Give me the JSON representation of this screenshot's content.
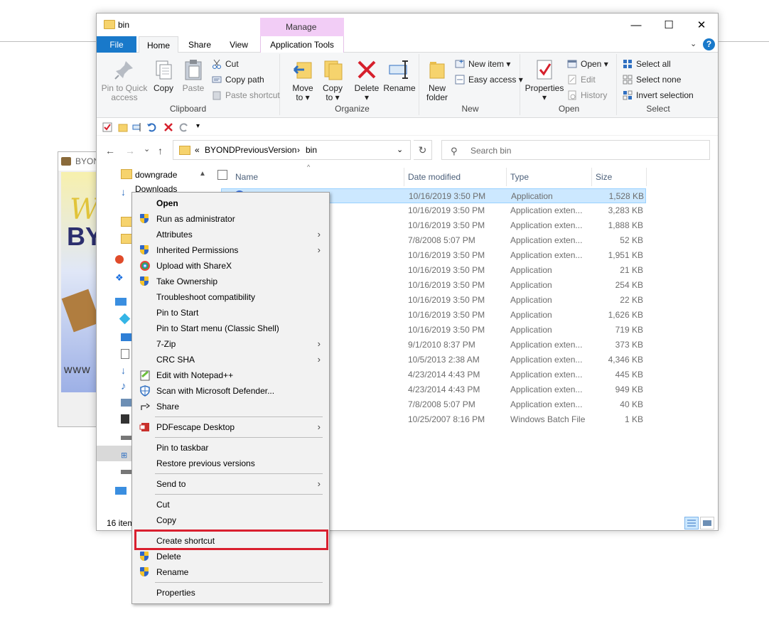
{
  "window": {
    "title": "bin",
    "manage_label": "Manage",
    "minimize": "—",
    "maximize": "☐",
    "close": "✕"
  },
  "tabs": {
    "file": "File",
    "home": "Home",
    "share": "Share",
    "view": "View",
    "app_tools": "Application Tools"
  },
  "ribbon": {
    "clipboard": {
      "label": "Clipboard",
      "pin_l1": "Pin to Quick",
      "pin_l2": "access",
      "copy": "Copy",
      "paste": "Paste",
      "cut": "Cut",
      "copy_path": "Copy path",
      "paste_shortcut": "Paste shortcut"
    },
    "organize": {
      "label": "Organize",
      "move_l1": "Move",
      "move_l2": "to ▾",
      "copy_l1": "Copy",
      "copy_l2": "to ▾",
      "delete_l1": "Delete",
      "delete_l2": "▾",
      "rename": "Rename"
    },
    "new": {
      "label": "New",
      "folder_l1": "New",
      "folder_l2": "folder",
      "new_item": "New item ▾",
      "easy_access": "Easy access ▾"
    },
    "open": {
      "label": "Open",
      "properties": "Properties",
      "properties_arrow": "▾",
      "open": "Open ▾",
      "edit": "Edit",
      "history": "History"
    },
    "select": {
      "label": "Select",
      "select_all": "Select all",
      "select_none": "Select none",
      "invert": "Invert selection"
    }
  },
  "address": {
    "back": "←",
    "forward": "→",
    "recent": "⌄",
    "up": "↑",
    "prefix": "«",
    "crumb1": "BYONDPreviousVersion",
    "sep": "›",
    "crumb2": "bin",
    "dropdown": "⌄",
    "refresh": "↻",
    "search_placeholder": "Search bin"
  },
  "nav": {
    "items": [
      "downgrade",
      "Downloads"
    ]
  },
  "columns": {
    "name": "Name",
    "date": "Date modified",
    "type": "Type",
    "size": "Size"
  },
  "files": [
    {
      "date": "10/16/2019 3:50 PM",
      "type": "Application",
      "size": "1,528 KB"
    },
    {
      "date": "10/16/2019 3:50 PM",
      "type": "Application exten...",
      "size": "3,283 KB"
    },
    {
      "date": "10/16/2019 3:50 PM",
      "type": "Application exten...",
      "size": "1,888 KB"
    },
    {
      "date": "7/8/2008 5:07 PM",
      "type": "Application exten...",
      "size": "52 KB"
    },
    {
      "date": "10/16/2019 3:50 PM",
      "type": "Application exten...",
      "size": "1,951 KB"
    },
    {
      "date": "10/16/2019 3:50 PM",
      "type": "Application",
      "size": "21 KB"
    },
    {
      "date": "10/16/2019 3:50 PM",
      "type": "Application",
      "size": "254 KB"
    },
    {
      "date": "10/16/2019 3:50 PM",
      "type": "Application",
      "size": "22 KB"
    },
    {
      "date": "10/16/2019 3:50 PM",
      "type": "Application",
      "size": "1,626 KB"
    },
    {
      "date": "10/16/2019 3:50 PM",
      "type": "Application",
      "size": "719 KB"
    },
    {
      "date": "9/1/2010 8:37 PM",
      "type": "Application exten...",
      "size": "373 KB"
    },
    {
      "date": "10/5/2013 2:38 AM",
      "type": "Application exten...",
      "size": "4,346 KB"
    },
    {
      "date": "4/23/2014 4:43 PM",
      "type": "Application exten...",
      "size": "445 KB"
    },
    {
      "date": "4/23/2014 4:43 PM",
      "type": "Application exten...",
      "size": "949 KB"
    },
    {
      "date": "7/8/2008 5:07 PM",
      "type": "Application exten...",
      "size": "40 KB"
    },
    {
      "date": "10/25/2007 8:16 PM",
      "type": "Windows Batch File",
      "size": "1 KB"
    }
  ],
  "status": {
    "items": "16 item"
  },
  "background_window": {
    "title": "BYON",
    "www": "www"
  },
  "menu": {
    "open": "Open",
    "run_admin": "Run as administrator",
    "attributes": "Attributes",
    "inherited": "Inherited Permissions",
    "sharex": "Upload with ShareX",
    "ownership": "Take Ownership",
    "troubleshoot": "Troubleshoot compatibility",
    "pin_start": "Pin to Start",
    "pin_start_classic": "Pin to Start menu (Classic Shell)",
    "zip": "7-Zip",
    "crc": "CRC SHA",
    "notepad": "Edit with Notepad++",
    "defender": "Scan with Microsoft Defender...",
    "share": "Share",
    "pdfescape": "PDFescape Desktop",
    "pin_taskbar": "Pin to taskbar",
    "restore": "Restore previous versions",
    "send_to": "Send to",
    "cut": "Cut",
    "copy": "Copy",
    "create_shortcut": "Create shortcut",
    "delete": "Delete",
    "rename": "Rename",
    "properties": "Properties",
    "submenu_arrow": "›"
  },
  "colors": {
    "accent": "#1979ca",
    "manage": "#f2cdf6",
    "highlight": "#d9202f",
    "selected_row": "#cce8ff"
  }
}
